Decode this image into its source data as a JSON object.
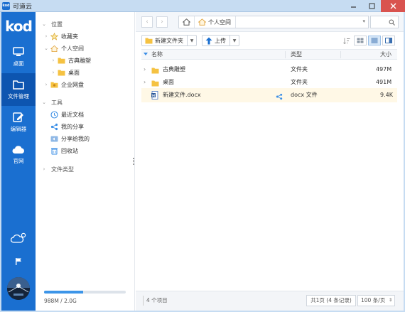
{
  "window": {
    "app_icon_text": "kod",
    "title": "可道云"
  },
  "colors": {
    "rail": "#1a6fd0",
    "rail_active": "#0d55b0",
    "folder": "#f5c242",
    "accent": "#3a8ee6"
  },
  "rail": {
    "logo": "kod",
    "items": [
      {
        "label": "桌面",
        "icon": "monitor-icon"
      },
      {
        "label": "文件管理",
        "icon": "folder-icon"
      },
      {
        "label": "编辑器",
        "icon": "edit-icon"
      },
      {
        "label": "官网",
        "icon": "cloud-icon"
      }
    ]
  },
  "tree": {
    "items": [
      {
        "label": "位置",
        "icon": "chevron-down-icon",
        "type": "section"
      },
      {
        "label": "收藏夹",
        "icon": "star-icon"
      },
      {
        "label": "个人空间",
        "icon": "home-folder-icon"
      },
      {
        "label": "古典雕塑",
        "icon": "folder-icon"
      },
      {
        "label": "桌面",
        "icon": "folder-icon"
      },
      {
        "label": "企业网盘",
        "icon": "group-folder-icon"
      },
      {
        "label": "工具",
        "icon": "chevron-down-icon",
        "type": "section"
      },
      {
        "label": "最近文档",
        "icon": "clock-icon"
      },
      {
        "label": "我的分享",
        "icon": "share-icon"
      },
      {
        "label": "分享给我的",
        "icon": "share-in-icon"
      },
      {
        "label": "回收站",
        "icon": "trash-icon"
      },
      {
        "label": "文件类型",
        "icon": "chevron-right-icon",
        "type": "section"
      }
    ],
    "quota": {
      "text": "988M / 2.0G",
      "used_fraction": 0.48
    }
  },
  "address": {
    "current": "个人空间"
  },
  "toolbar": {
    "new_folder": "新建文件夹",
    "upload": "上传"
  },
  "table": {
    "columns": [
      "名称",
      "类型",
      "大小"
    ],
    "rows": [
      {
        "name": "古典雕塑",
        "type": "文件夹",
        "size": "497M",
        "icon": "folder-icon"
      },
      {
        "name": "桌面",
        "type": "文件夹",
        "size": "491M",
        "icon": "folder-icon"
      },
      {
        "name": "新建文件.docx",
        "type": "docx 文件",
        "size": "9.4K",
        "icon": "word-icon",
        "shared": true
      }
    ]
  },
  "status": {
    "count": "4 个项目",
    "pager": "共1页 (4 条记录)",
    "page_size": "100 条/页"
  }
}
